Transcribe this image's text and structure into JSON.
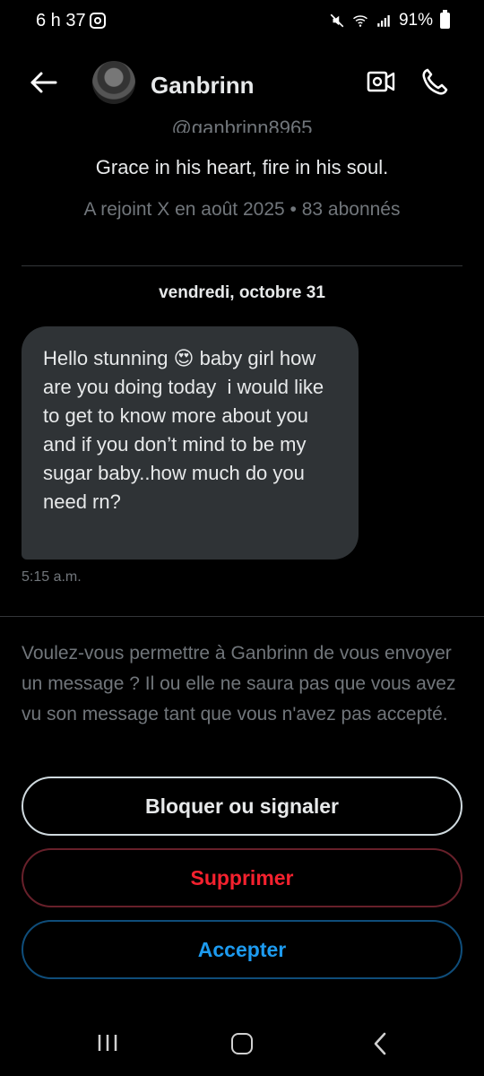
{
  "status_bar": {
    "time": "6 h 37",
    "battery": "91%",
    "icons": [
      "instagram-icon",
      "mute-icon",
      "wifi-icon",
      "signal-icon",
      "battery-icon"
    ]
  },
  "header": {
    "name": "Ganbrinn",
    "icons": [
      "back-arrow-icon",
      "video-call-icon",
      "phone-icon"
    ]
  },
  "profile": {
    "handle": "@ganbrinn8965",
    "bio": "Grace in his heart, fire in his soul.",
    "joined": "A rejoint X en août 2025 • 83 abonnés"
  },
  "conversation": {
    "date": "vendredi, octobre 31",
    "messages": [
      {
        "text": "Hello stunning 😍 baby girl how are you doing today  i would like to get to know more about you and if you don’t mind to be my sugar baby..how much do you need rn?",
        "time": "5:15 a.m."
      }
    ]
  },
  "request": {
    "prompt": "Voulez-vous permettre à Ganbrinn de vous envoyer un message ? Il ou elle ne saura pas que vous avez vu son message tant que vous n'avez pas accepté.",
    "block_label": "Bloquer ou signaler",
    "delete_label": "Supprimer",
    "accept_label": "Accepter"
  },
  "colors": {
    "background": "#000000",
    "bubble": "#2f3336",
    "muted_text": "#71767b",
    "danger": "#f4212e",
    "accent": "#1d9bf0"
  }
}
